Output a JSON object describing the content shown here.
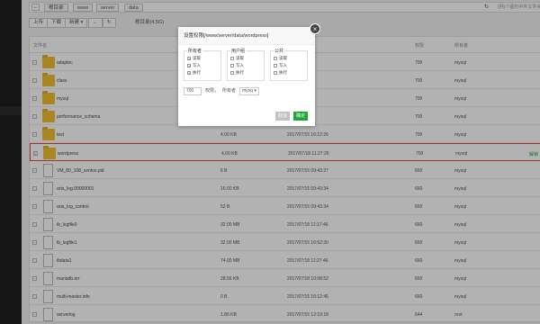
{
  "pathbar": {
    "back_icon": "←",
    "crumbs": [
      "根目录",
      "www",
      "server",
      "data"
    ],
    "refresh_icon": "↻",
    "search_placeholder": "(例)个图形中件文件夹如:"
  },
  "toolbar": {
    "upload": "上传",
    "download": "下载",
    "new": "新建 ▾",
    "back_icon": "←",
    "refresh_icon": "↻",
    "disk": "根目录(4.5G)"
  },
  "table": {
    "headers": {
      "name": "文件名",
      "size": "",
      "mtime": "",
      "perm": "权限",
      "owner": "所有者"
    },
    "rows": [
      {
        "type": "folder",
        "name": "adaptec",
        "size": "",
        "mtime": "25:15",
        "perm": "700",
        "owner": "mysql"
      },
      {
        "type": "folder",
        "name": "class",
        "size": "",
        "mtime": "22:09",
        "perm": "700",
        "owner": "mysql"
      },
      {
        "type": "folder",
        "name": "mysql",
        "size": "",
        "mtime": "12:31",
        "perm": "700",
        "owner": "mysql"
      },
      {
        "type": "folder",
        "name": "performance_schema",
        "size": "",
        "mtime": "12:38",
        "perm": "700",
        "owner": "mysql"
      },
      {
        "type": "folder",
        "name": "test",
        "size": "4.00 KB",
        "mtime": "2017/07/15 16:12:26",
        "perm": "700",
        "owner": "mysql"
      },
      {
        "type": "folder",
        "name": "wordpress",
        "size": "4.00 KB",
        "mtime": "2017/07/18 11:27:26",
        "perm": "700",
        "owner": "mysql",
        "selected": true,
        "op": "解锁"
      },
      {
        "type": "file",
        "name": "VM_80_108_centos.pid",
        "size": "6 B",
        "mtime": "2017/07/15 09:43:27",
        "perm": "660",
        "owner": "mysql"
      },
      {
        "type": "file",
        "name": "aria_log.00000001",
        "size": "16.00 KB",
        "mtime": "2017/07/15 09:43:34",
        "perm": "660",
        "owner": "mysql"
      },
      {
        "type": "file",
        "name": "aria_log_control",
        "size": "52 B",
        "mtime": "2017/07/15 09:43:34",
        "perm": "660",
        "owner": "mysql"
      },
      {
        "type": "file",
        "name": "ib_logfile0",
        "size": "32.00 MB",
        "mtime": "2017/07/18 11:17:46",
        "perm": "660",
        "owner": "mysql"
      },
      {
        "type": "file",
        "name": "ib_logfile1",
        "size": "32.00 MB",
        "mtime": "2017/07/15 16:52:30",
        "perm": "660",
        "owner": "mysql"
      },
      {
        "type": "file",
        "name": "ibdata1",
        "size": "74.00 MB",
        "mtime": "2017/07/18 11:27:46",
        "perm": "660",
        "owner": "mysql"
      },
      {
        "type": "file",
        "name": "mariadb.err",
        "size": "28.56 KB",
        "mtime": "2017/07/18 10:08:52",
        "perm": "660",
        "owner": "mysql"
      },
      {
        "type": "file",
        "name": "multi-master.info",
        "size": "0 B",
        "mtime": "2017/07/15 16:12:45",
        "perm": "660",
        "owner": "mysql"
      },
      {
        "type": "file",
        "name": "serverlog",
        "size": "1.86 KB",
        "mtime": "2017/07/15 12:19:18",
        "perm": "644",
        "owner": "root"
      }
    ]
  },
  "dialog": {
    "title": "设置权限[/www/server/data/wordpress]",
    "close_icon": "×",
    "groups": [
      {
        "title": "所有者",
        "items": [
          {
            "label": "读取",
            "checked": true
          },
          {
            "label": "写入",
            "checked": true
          },
          {
            "label": "执行",
            "checked": true
          }
        ]
      },
      {
        "title": "用户组",
        "items": [
          {
            "label": "读取",
            "checked": false
          },
          {
            "label": "写入",
            "checked": false
          },
          {
            "label": "执行",
            "checked": false
          }
        ]
      },
      {
        "title": "公共",
        "items": [
          {
            "label": "读取",
            "checked": false
          },
          {
            "label": "写入",
            "checked": false
          },
          {
            "label": "执行",
            "checked": false
          }
        ]
      }
    ],
    "perm_value": "700",
    "perm_label": "权限，",
    "owner_label": "所有者",
    "owner_value": "mysq ▾",
    "cancel_label": "取消",
    "confirm_label": "确定",
    "cancel_color": "#c2c2c2",
    "confirm_color": "#20a53a"
  }
}
